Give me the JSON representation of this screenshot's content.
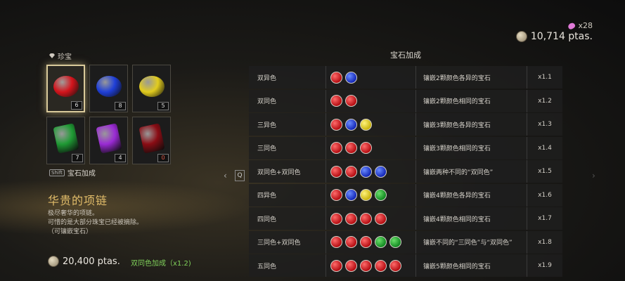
{
  "currency": {
    "gem_count": "x28",
    "money": "10,714 ptas."
  },
  "treasure": {
    "label": "珍宝",
    "gems": [
      {
        "shape": "round",
        "color": "#d4141c",
        "count": "6",
        "selected": true
      },
      {
        "shape": "round",
        "color": "#1f3fd8",
        "count": "8",
        "selected": false
      },
      {
        "shape": "round",
        "color": "#e2cc1e",
        "count": "5",
        "selected": false
      },
      {
        "shape": "rect",
        "color": "#1f9a34",
        "count": "7",
        "selected": false
      },
      {
        "shape": "rect",
        "color": "#9a2ad4",
        "count": "4",
        "selected": false
      },
      {
        "shape": "rect",
        "color": "#8a0c14",
        "count": "0",
        "selected": false
      }
    ],
    "shift_key": "Shift",
    "shift_label": "宝石加成"
  },
  "item": {
    "title": "华贵的项链",
    "desc": [
      "极尽奢华的项链。",
      "可惜的是大部分珠宝已经被摘除。",
      "（可镶嵌宝石）"
    ],
    "price": "20,400 ptas.",
    "bonus": "双同色加成（x1.2)"
  },
  "nav": {
    "prev_key": "Q"
  },
  "table": {
    "title": "宝石加成",
    "rows": [
      {
        "name": "双异色",
        "gems": [
          "red",
          "blue"
        ],
        "desc": "镶嵌2颗颜色各异的宝石",
        "mult": "x1.1"
      },
      {
        "name": "双同色",
        "gems": [
          "red",
          "red"
        ],
        "desc": "镶嵌2颗颜色相同的宝石",
        "mult": "x1.2"
      },
      {
        "name": "三异色",
        "gems": [
          "red",
          "blue",
          "yellow"
        ],
        "desc": "镶嵌3颗颜色各异的宝石",
        "mult": "x1.3"
      },
      {
        "name": "三同色",
        "gems": [
          "red",
          "red",
          "red"
        ],
        "desc": "镶嵌3颗颜色相同的宝石",
        "mult": "x1.4"
      },
      {
        "name": "双同色+双同色",
        "gems": [
          "red",
          "red",
          "blue",
          "blue"
        ],
        "desc": "镶嵌两种不同的“双同色”",
        "mult": "x1.5"
      },
      {
        "name": "四异色",
        "gems": [
          "red",
          "blue",
          "yellow",
          "green"
        ],
        "desc": "镶嵌4颗颜色各异的宝石",
        "mult": "x1.6"
      },
      {
        "name": "四同色",
        "gems": [
          "red",
          "red",
          "red",
          "red"
        ],
        "desc": "镶嵌4颗颜色相同的宝石",
        "mult": "x1.7"
      },
      {
        "name": "三同色+双同色",
        "gems": [
          "red",
          "red",
          "red",
          "green",
          "green"
        ],
        "desc": "镶嵌不同的“三同色”与“双同色”",
        "mult": "x1.8"
      },
      {
        "name": "五同色",
        "gems": [
          "red",
          "red",
          "red",
          "red",
          "red"
        ],
        "desc": "镶嵌5颗颜色相同的宝石",
        "mult": "x1.9"
      }
    ]
  }
}
